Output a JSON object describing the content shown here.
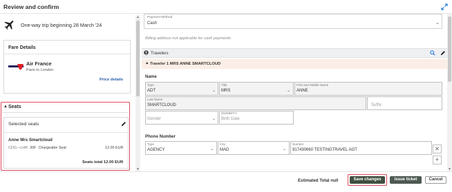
{
  "header": {
    "title": "Review and confirm"
  },
  "trip": {
    "summary": "One-way trip beginning 28 March '24"
  },
  "fare_details": {
    "title": "Fare Details",
    "airline": "Air France",
    "route": "Paris to London",
    "price_details_link": "Price details"
  },
  "seats": {
    "title": "Seats",
    "selected_title": "Selected seats",
    "passenger": "Anne Mrs Smartcloud",
    "segment": "CDG—LHR",
    "seat": "30F",
    "seat_type": "Chargeable Seat",
    "price": "12.00 EUR",
    "total": "Seats total 12.00 EUR"
  },
  "payment": {
    "label": "Payment Method",
    "value": "Cash",
    "billing_note": "Billing address not applicable for cash payments"
  },
  "travelers": {
    "label": "Travelers",
    "traveler_title": "Traveler 1 MRS ANNE SMARTCLOUD"
  },
  "name_section": {
    "title": "Name",
    "type_label": "Type",
    "type_value": "ADT",
    "title_label": "Title",
    "title_value": "MRS",
    "first_label": "First and Middle Name",
    "first_value": "ANNE",
    "last_label": "Last Name",
    "last_value": "SMARTCLOUD",
    "suffix_placeholder": "Suffix",
    "gender_placeholder": "Gender",
    "dob_label": "DD/MM/YY",
    "dob_placeholder": "Birth Date"
  },
  "phone_section": {
    "title": "Phone Number",
    "type_label": "Type",
    "type_value": "AGENCY",
    "city_label": "City",
    "city_value": "MAD",
    "number_label": "Number",
    "number_value": "917430660 TESTINGTRAVEL AGT"
  },
  "footer": {
    "estimated_total": "Estimated Total null",
    "save_button": "Save changes",
    "issue_button": "Issue ticket",
    "cancel_button": "Cancel"
  },
  "colors": {
    "highlight_outline": "#e0475b",
    "save_bg": "#3f4f3f",
    "issue_bg": "#4d5a52",
    "traveler_bar": "#fbeee6",
    "link": "#2a5ea8"
  }
}
